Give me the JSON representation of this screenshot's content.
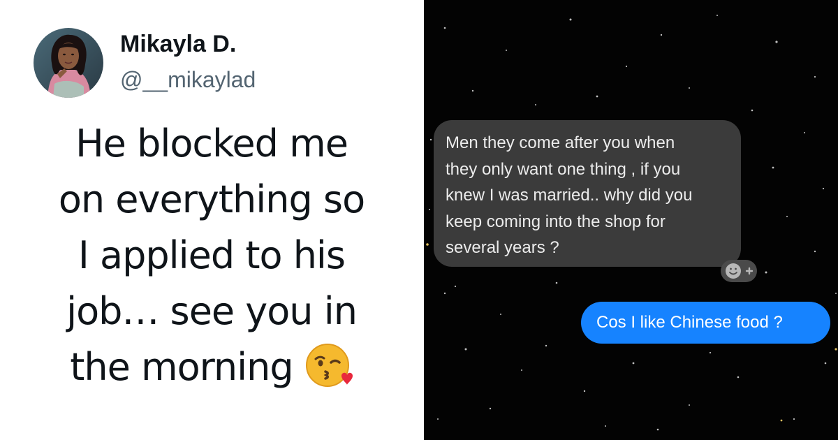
{
  "tweet": {
    "author_name": "Mikayla D.",
    "author_handle": "@__mikaylad",
    "text_lines": [
      "He blocked me",
      "on everything so",
      "I applied to his",
      "job… see you in",
      "the morning"
    ],
    "emoji_icon": "kissing-face-with-heart-emoji"
  },
  "chat": {
    "incoming_message_lines": [
      "Men they come after you when",
      "they only want one thing , if you",
      "knew I was married.. why did you",
      "keep coming into the shop for",
      "several years ?"
    ],
    "reaction_icon": "add-reaction-icon",
    "outgoing_message": "Cos I like Chinese food ?"
  },
  "colors": {
    "tweet_background": "#ffffff",
    "tweet_text": "#0f1419",
    "handle_text": "#536471",
    "chat_background": "#030303",
    "incoming_bubble": "#3b3b3b",
    "outgoing_bubble": "#1683ff"
  }
}
